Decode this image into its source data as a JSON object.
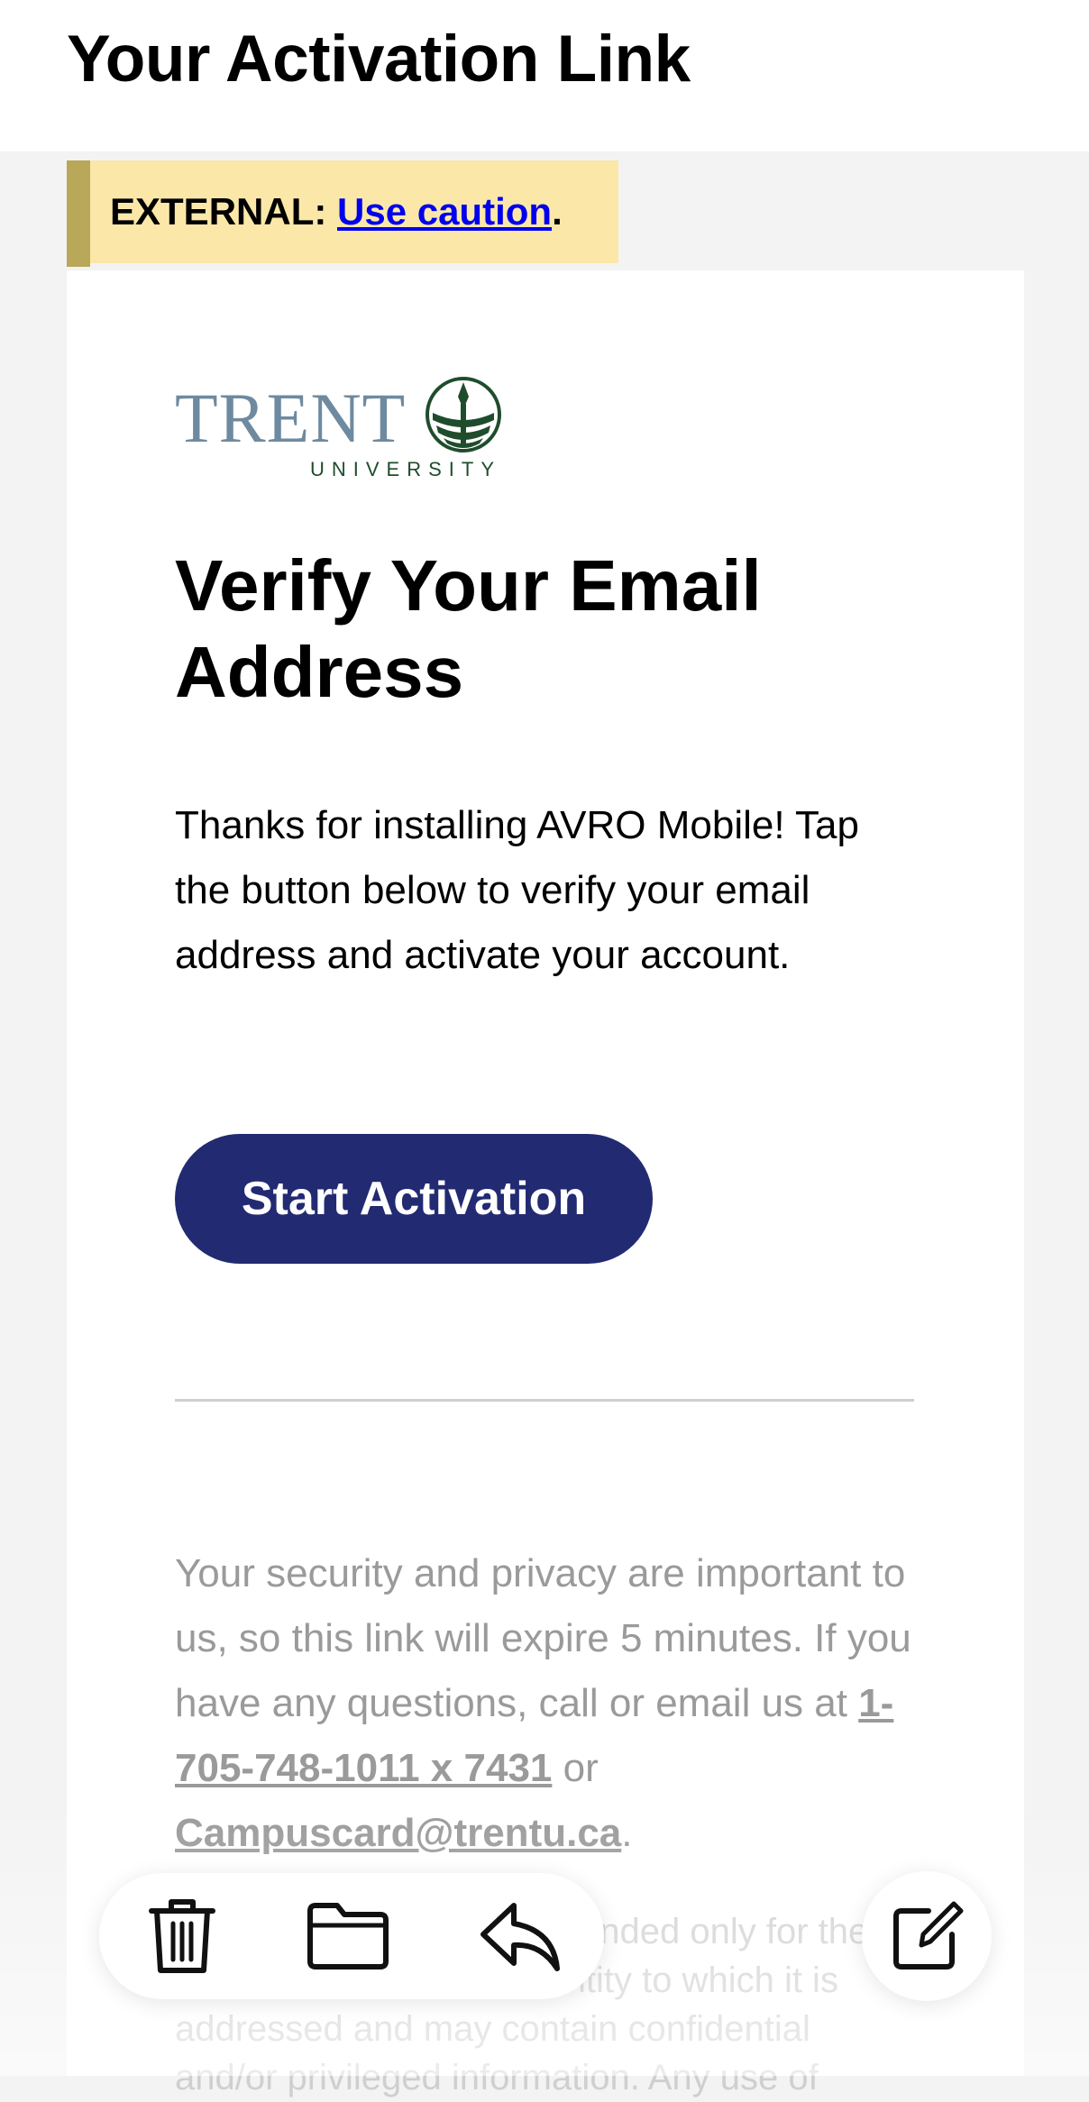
{
  "header": {
    "title": "Your Activation Link"
  },
  "caution_banner": {
    "prefix": "EXTERNAL: ",
    "link": "Use caution",
    "suffix": "."
  },
  "email": {
    "logo": {
      "word": "TRENT",
      "sub": "UNIVERSITY"
    },
    "title": "Verify Your Email Address",
    "body": "Thanks for installing AVRO Mobile! Tap the button below to verify your email address and activate your account.",
    "button_label": "Start Activation",
    "footer": {
      "text_before": "Your security and privacy are important to us, so this link will expire 5 minutes. If you have any questions, call or email us at ",
      "phone": "1-705-748-1011 x 7431",
      "or": " or ",
      "email": "Campuscard@trentu.ca",
      "end": "."
    },
    "legal": "This communication is intended only for the use of the individual or entity to which it is addressed and may contain confidential and/or privileged information. Any use of"
  },
  "toolbar": {
    "items": [
      {
        "icon": "trash-icon"
      },
      {
        "icon": "folder-icon"
      },
      {
        "icon": "reply-icon"
      }
    ],
    "compose_icon": "compose-icon"
  },
  "colors": {
    "accent_button": "#222a72",
    "caution_bg": "#fbe8a9",
    "caution_bar": "#b9a75a",
    "logo_text": "#6e8aa0",
    "logo_green": "#1f4d2c"
  }
}
